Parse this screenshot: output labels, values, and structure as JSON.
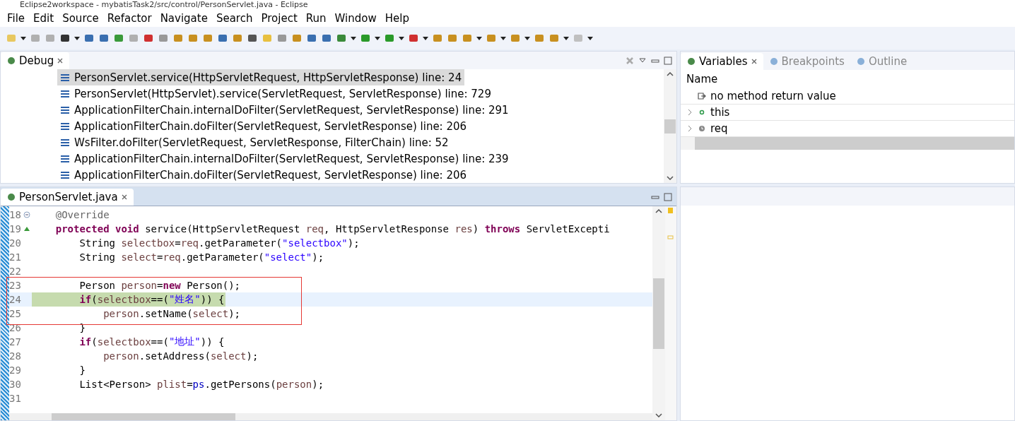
{
  "window": {
    "title": "Eclipse2workspace - mybatisTask2/src/control/PersonServlet.java - Eclipse"
  },
  "menu": [
    "File",
    "Edit",
    "Source",
    "Refactor",
    "Navigate",
    "Search",
    "Project",
    "Run",
    "Window",
    "Help"
  ],
  "debug_view": {
    "tab": {
      "label": "Debug",
      "selected": true
    },
    "frames": [
      {
        "text": "PersonServlet.service(HttpServletRequest, HttpServletResponse) line: 24",
        "selected": true
      },
      {
        "text": "PersonServlet(HttpServlet).service(ServletRequest, ServletResponse) line: 729",
        "selected": false
      },
      {
        "text": "ApplicationFilterChain.internalDoFilter(ServletRequest, ServletResponse) line: 291",
        "selected": false
      },
      {
        "text": "ApplicationFilterChain.doFilter(ServletRequest, ServletResponse) line: 206",
        "selected": false
      },
      {
        "text": "WsFilter.doFilter(ServletRequest, ServletResponse, FilterChain) line: 52",
        "selected": false
      },
      {
        "text": "ApplicationFilterChain.internalDoFilter(ServletRequest, ServletResponse) line: 239",
        "selected": false
      },
      {
        "text": "ApplicationFilterChain.doFilter(ServletRequest, ServletResponse) line: 206",
        "selected": false
      }
    ]
  },
  "variables_view": {
    "tabs": [
      {
        "label": "Variables",
        "selected": true
      },
      {
        "label": "Breakpoints",
        "selected": false
      },
      {
        "label": "Outline",
        "selected": false
      }
    ],
    "column": "Name",
    "rows": [
      {
        "name": "no method return value",
        "kind": "return"
      },
      {
        "name": "this",
        "kind": "object"
      },
      {
        "name": "req",
        "kind": "local"
      }
    ]
  },
  "editor": {
    "tab": {
      "label": "PersonServlet.java",
      "selected": true
    },
    "lines": [
      {
        "num": "18",
        "current": false,
        "kind": "fold",
        "tokens": [
          {
            "kind": "ann",
            "text": "    @Override"
          }
        ]
      },
      {
        "num": "19",
        "current": false,
        "kind": "override",
        "tokens": [
          {
            "kind": "kw",
            "text": "    protected"
          },
          {
            "kind": "kw",
            "text": " void"
          },
          {
            "kind": "plain",
            "text": " service(HttpServletRequest "
          },
          {
            "kind": "var",
            "text": "req"
          },
          {
            "kind": "plain",
            "text": ", HttpServletResponse "
          },
          {
            "kind": "var",
            "text": "res"
          },
          {
            "kind": "plain",
            "text": ") "
          },
          {
            "kind": "kw",
            "text": "throws"
          },
          {
            "kind": "plain",
            "text": " ServletExcepti"
          }
        ]
      },
      {
        "num": "20",
        "current": false,
        "tokens": [
          {
            "kind": "plain",
            "text": "        String "
          },
          {
            "kind": "var",
            "text": "selectbox"
          },
          {
            "kind": "plain",
            "text": "="
          },
          {
            "kind": "var",
            "text": "req"
          },
          {
            "kind": "plain",
            "text": ".getParameter("
          },
          {
            "kind": "str",
            "text": "\"selectbox\""
          },
          {
            "kind": "plain",
            "text": ");"
          }
        ]
      },
      {
        "num": "21",
        "current": false,
        "tokens": [
          {
            "kind": "plain",
            "text": "        String "
          },
          {
            "kind": "var",
            "text": "select"
          },
          {
            "kind": "plain",
            "text": "="
          },
          {
            "kind": "var",
            "text": "req"
          },
          {
            "kind": "plain",
            "text": ".getParameter("
          },
          {
            "kind": "str",
            "text": "\"select\""
          },
          {
            "kind": "plain",
            "text": ");"
          }
        ]
      },
      {
        "num": "22",
        "current": false
      },
      {
        "num": "23",
        "current": false,
        "tokens": [
          {
            "kind": "plain",
            "text": "        Person "
          },
          {
            "kind": "var",
            "text": "person"
          },
          {
            "kind": "plain",
            "text": "="
          },
          {
            "kind": "kw",
            "text": "new"
          },
          {
            "kind": "plain",
            "text": " Person();"
          }
        ]
      },
      {
        "num": "24",
        "current": true,
        "tokens": [
          {
            "kind": "kw",
            "text": "        if"
          },
          {
            "kind": "plain",
            "text": "("
          },
          {
            "kind": "var",
            "text": "selectbox"
          },
          {
            "kind": "plain",
            "text": "==("
          },
          {
            "kind": "str",
            "text": "\"姓名\""
          },
          {
            "kind": "plain",
            "text": ")) {"
          }
        ]
      },
      {
        "num": "25",
        "current": false,
        "tokens": [
          {
            "kind": "var",
            "text": "            person"
          },
          {
            "kind": "plain",
            "text": ".setName("
          },
          {
            "kind": "var",
            "text": "select"
          },
          {
            "kind": "plain",
            "text": ");"
          }
        ]
      },
      {
        "num": "26",
        "current": false,
        "tokens": [
          {
            "kind": "plain",
            "text": "        }"
          }
        ]
      },
      {
        "num": "27",
        "current": false,
        "tokens": [
          {
            "kind": "kw",
            "text": "        if"
          },
          {
            "kind": "plain",
            "text": "("
          },
          {
            "kind": "var",
            "text": "selectbox"
          },
          {
            "kind": "plain",
            "text": "==("
          },
          {
            "kind": "str",
            "text": "\"地址\""
          },
          {
            "kind": "plain",
            "text": ")) {"
          }
        ]
      },
      {
        "num": "28",
        "current": false,
        "tokens": [
          {
            "kind": "var",
            "text": "            person"
          },
          {
            "kind": "plain",
            "text": ".setAddress("
          },
          {
            "kind": "var",
            "text": "select"
          },
          {
            "kind": "plain",
            "text": ");"
          }
        ]
      },
      {
        "num": "29",
        "current": false,
        "tokens": [
          {
            "kind": "plain",
            "text": "        }"
          }
        ]
      },
      {
        "num": "30",
        "current": false,
        "tokens": [
          {
            "kind": "plain",
            "text": "        List<Person> "
          },
          {
            "kind": "var",
            "text": "plist"
          },
          {
            "kind": "plain",
            "text": "="
          },
          {
            "kind": "field",
            "text": "ps"
          },
          {
            "kind": "plain",
            "text": ".getPersons("
          },
          {
            "kind": "var",
            "text": "person"
          },
          {
            "kind": "plain",
            "text": ");"
          }
        ]
      },
      {
        "num": "31",
        "current": false
      }
    ]
  }
}
